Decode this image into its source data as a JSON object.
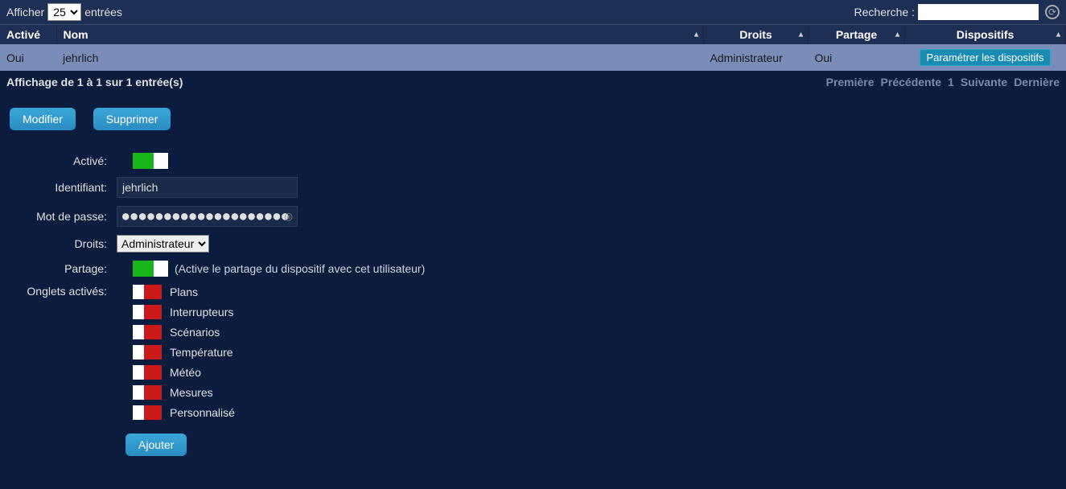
{
  "topbar": {
    "show_label": "Afficher",
    "entries_value": "25",
    "entries_label": "entrées",
    "search_label": "Recherche :"
  },
  "table": {
    "headers": {
      "active": "Activé",
      "name": "Nom",
      "rights": "Droits",
      "sharing": "Partage",
      "devices": "Dispositifs"
    },
    "row": {
      "active": "Oui",
      "name": "jehrlich",
      "rights": "Administrateur",
      "sharing": "Oui",
      "device_btn": "Paramétrer les dispositifs"
    }
  },
  "footer": {
    "info": "Affichage de 1 à 1 sur 1 entrée(s)",
    "first": "Première",
    "prev": "Précédente",
    "page": "1",
    "next": "Suivante",
    "last": "Dernière"
  },
  "actions": {
    "modify": "Modifier",
    "delete": "Supprimer"
  },
  "form": {
    "active_label": "Activé:",
    "id_label": "Identifiant:",
    "id_value": "jehrlich",
    "pwd_label": "Mot de passe:",
    "pwd_value": "●●●●●●●●●●●●●●●●●●●●",
    "rights_label": "Droits:",
    "rights_value": "Administrateur",
    "sharing_label": "Partage:",
    "sharing_hint": "(Active le partage du dispositif avec cet utilisateur)",
    "tabs_label": "Onglets activés:",
    "tabs": [
      "Plans",
      "Interrupteurs",
      "Scénarios",
      "Température",
      "Météo",
      "Mesures",
      "Personnalisé"
    ],
    "add_btn": "Ajouter"
  }
}
